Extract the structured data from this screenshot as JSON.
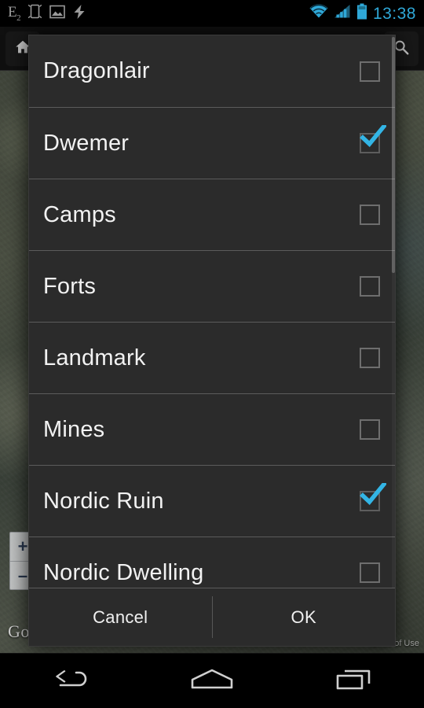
{
  "status_bar": {
    "left_icons": [
      {
        "name": "edge-network-icon",
        "glyph": "E",
        "sub": "2"
      },
      {
        "name": "screen-rotation-icon"
      },
      {
        "name": "screenshot-image-icon"
      },
      {
        "name": "charging-bolt-icon"
      }
    ],
    "right_icons": [
      {
        "name": "wifi-icon"
      },
      {
        "name": "cellular-signal-icon"
      },
      {
        "name": "battery-icon"
      }
    ],
    "clock": "13:38",
    "clock_color": "#2fa8d8"
  },
  "background_app": {
    "home_button_label": "home-icon",
    "search_button_label": "search-icon",
    "search_placeholder": "",
    "zoom_in_label": "+",
    "zoom_out_label": "–",
    "map_attribution": "Google",
    "terms_label": "Terms of Use"
  },
  "dialog": {
    "options": [
      {
        "label": "Dragonlair",
        "checked": false
      },
      {
        "label": "Dwemer",
        "checked": true
      },
      {
        "label": "Camps",
        "checked": false
      },
      {
        "label": "Forts",
        "checked": false
      },
      {
        "label": "Landmark",
        "checked": false
      },
      {
        "label": "Mines",
        "checked": false
      },
      {
        "label": "Nordic Ruin",
        "checked": true
      },
      {
        "label": "Nordic Dwelling",
        "checked": false
      }
    ],
    "cancel_label": "Cancel",
    "ok_label": "OK",
    "accent_color": "#33b5e5",
    "background_color": "#2b2b2b",
    "divider_color": "#5b5b5b"
  },
  "nav_bar": {
    "back_label": "back-icon",
    "home_label": "home-icon",
    "recents_label": "recents-icon"
  }
}
